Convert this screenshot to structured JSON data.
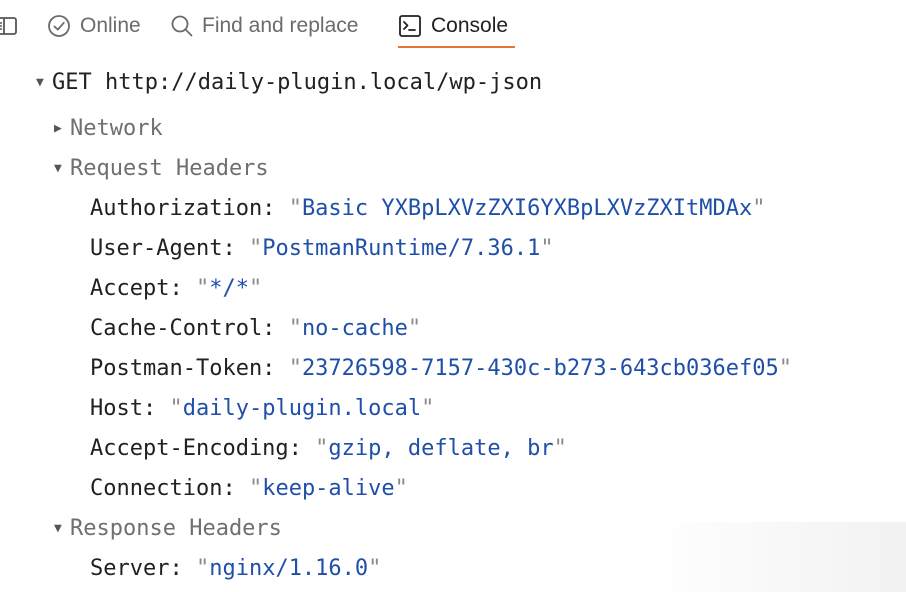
{
  "tabs": [
    {
      "label": "Online",
      "icon": "check-circle-icon"
    },
    {
      "label": "Find and replace",
      "icon": "search-icon"
    },
    {
      "label": "Console",
      "icon": "terminal-icon",
      "active": true
    }
  ],
  "accent_color": "#e8733a",
  "value_color": "#1f4fa8",
  "console": {
    "request": {
      "method": "GET",
      "url": "http://daily-plugin.local/wp-json"
    },
    "network_label": "Network",
    "request_headers_label": "Request Headers",
    "request_headers": [
      {
        "key": "Authorization:",
        "value": "Basic YXBpLXVzZXI6YXBpLXVzZXItMDAx"
      },
      {
        "key": "User-Agent:",
        "value": "PostmanRuntime/7.36.1"
      },
      {
        "key": "Accept:",
        "value": "*/*"
      },
      {
        "key": "Cache-Control:",
        "value": "no-cache"
      },
      {
        "key": "Postman-Token:",
        "value": "23726598-7157-430c-b273-643cb036ef05"
      },
      {
        "key": "Host:",
        "value": "daily-plugin.local"
      },
      {
        "key": "Accept-Encoding:",
        "value": "gzip, deflate, br"
      },
      {
        "key": "Connection:",
        "value": "keep-alive"
      }
    ],
    "response_headers_label": "Response Headers",
    "response_headers": [
      {
        "key": "Server:",
        "value": "nginx/1.16.0"
      }
    ]
  }
}
